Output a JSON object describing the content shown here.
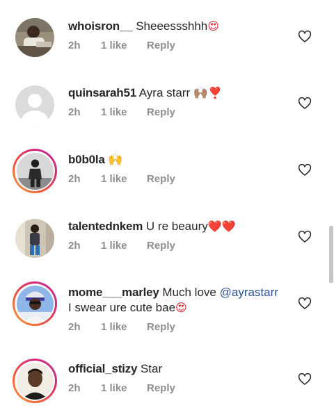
{
  "comments": [
    {
      "username": "whoisron__",
      "text": "Sheeessshhh",
      "emoji": "😍",
      "time": "2h",
      "likes": "1 like",
      "reply": "Reply",
      "avatar": "photo-person-seated"
    },
    {
      "username": "quinsarah51",
      "text": "Ayra starr 🙌🏽",
      "emoji": "❣️",
      "time": "2h",
      "likes": "1 like",
      "reply": "Reply",
      "avatar": "default-gray-avatar"
    },
    {
      "username": "b0b0la",
      "text": "🙌",
      "emoji": "",
      "time": "2h",
      "likes": "1 like",
      "reply": "Reply",
      "avatar": "photo-bw-person"
    },
    {
      "username": "talentednkem",
      "text": "U re beaury",
      "emoji": "❤️❤️",
      "time": "2h",
      "likes": "1 like",
      "reply": "Reply",
      "avatar": "photo-person-standing"
    },
    {
      "username": "mome___marley",
      "text": "Much love",
      "mention": "@ayrastarr",
      "text2": "I swear ure cute bae",
      "emoji": "😍",
      "time": "2h",
      "likes": "1 like",
      "reply": "Reply",
      "avatar": "photo-person-hat"
    },
    {
      "username": "official_stizy",
      "text": "Star",
      "emoji": "",
      "time": "2h",
      "likes": "1 like",
      "reply": "Reply",
      "avatar": "photo-person-portrait"
    }
  ],
  "icons": {
    "like": "heart-outline-icon"
  },
  "colors": {
    "text": "#262626",
    "meta": "#8e8e8e",
    "mention": "#2a4f92",
    "story_ring_start": "#f9a23a",
    "story_ring_end": "#c0359a"
  }
}
